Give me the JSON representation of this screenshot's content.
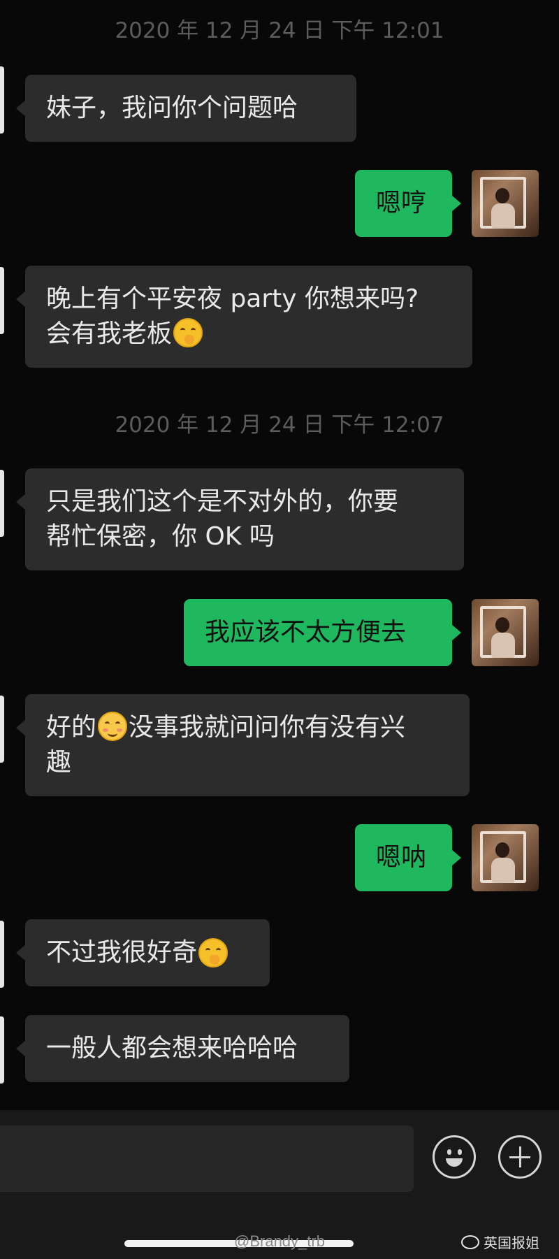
{
  "timestamps": [
    "2020 年 12 月 24 日 下午 12:01",
    "2020 年 12 月 24 日 下午 12:07"
  ],
  "messages": [
    {
      "side": "in",
      "text": "妹子，我问你个问题哈"
    },
    {
      "side": "out",
      "text": "嗯哼"
    },
    {
      "side": "in",
      "text": "晚上有个平安夜 party 你想来吗?",
      "line2": "会有我老板",
      "emoji": "thinking-face-emoji"
    },
    {
      "side": "in",
      "text": "只是我们这个是不对外的，你要",
      "line2": "帮忙保密，你 OK 吗"
    },
    {
      "side": "out",
      "text": "我应该不太方便去"
    },
    {
      "side": "in",
      "text_before": "好的",
      "emoji": "smiling-face-emoji",
      "text": "没事我就问问你有没有兴",
      "line2": "趣"
    },
    {
      "side": "out",
      "text": "嗯呐"
    },
    {
      "side": "in",
      "text": "不过我很好奇",
      "emoji": "thinking-face-emoji"
    },
    {
      "side": "in",
      "text": "一般人都会想来哈哈哈"
    }
  ],
  "input_bar": {
    "emoji_icon": "emoji-icon",
    "plus_icon": "plus-icon"
  },
  "watermark": "@Brandy_trb",
  "brand": "英国报姐"
}
